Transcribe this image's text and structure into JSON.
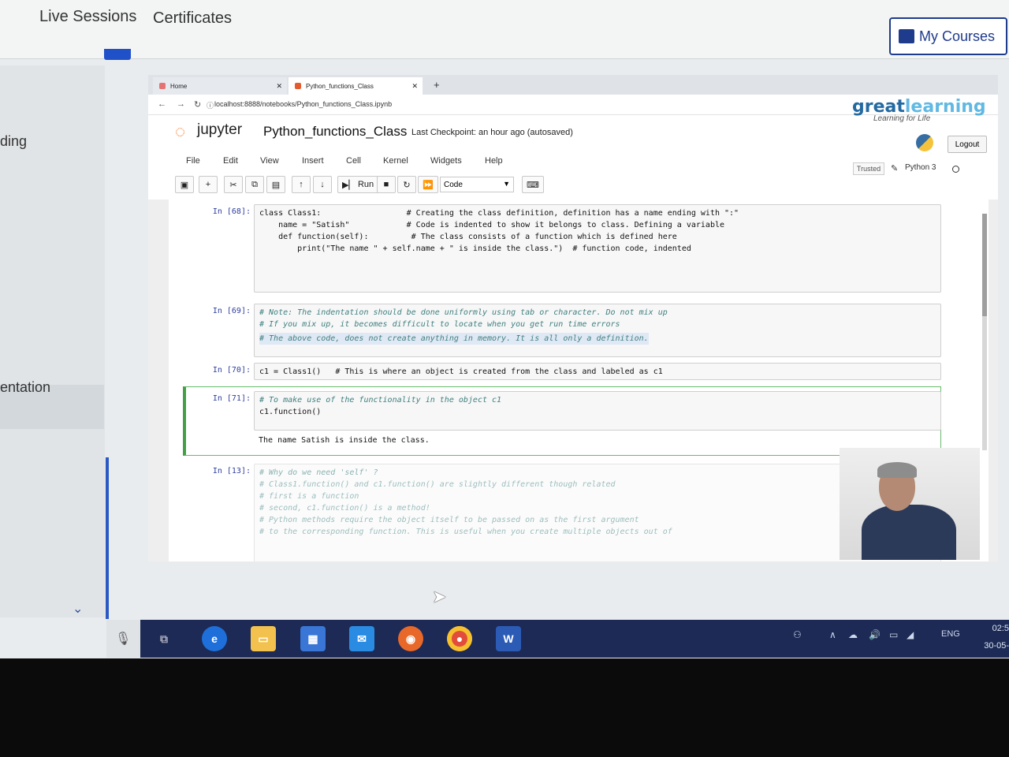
{
  "site": {
    "nav": [
      "Live Sessions",
      "Certificates"
    ],
    "my_courses": "My Courses"
  },
  "sidebar": {
    "items": [
      "ding",
      "entation"
    ]
  },
  "browser": {
    "tabs": [
      {
        "label": "Home"
      },
      {
        "label": "Python_functions_Class"
      }
    ],
    "new_tab": "+",
    "url": "localhost:8888/notebooks/Python_functions_Class.ipynb",
    "brand_logo": {
      "main": "great",
      "accent": "learning",
      "tagline": "Learning for Life"
    }
  },
  "jupyter": {
    "logo_text": "jupyter",
    "notebook_name": "Python_functions_Class",
    "checkpoint": "Last Checkpoint: an hour ago  (autosaved)",
    "logout": "Logout",
    "menu": [
      "File",
      "Edit",
      "View",
      "Insert",
      "Cell",
      "Kernel",
      "Widgets",
      "Help"
    ],
    "trusted": "Trusted",
    "kernel": "Python 3",
    "toolbar": {
      "run": "Run",
      "cell_type": "Code"
    }
  },
  "cells": [
    {
      "prompt": "In [68]:",
      "lines": [
        "class Class1:                  # Creating the class definition, definition has a name ending with \":\"",
        "    name = \"Satish\"            # Code is indented to show it belongs to class. Defining a variable",
        "    def function(self):         # The class consists of a function which is defined here",
        "        print(\"The name \" + self.name + \" is inside the class.\")  # function code, indented"
      ]
    },
    {
      "prompt": "In [69]:",
      "lines": [
        "# Note: The indentation should be done uniformly using tab or character. Do not mix up",
        "# If you mix up, it becomes difficult to locate when you get run time errors",
        "",
        "# The above code, does not create anything in memory. It is all only a definition."
      ]
    },
    {
      "prompt": "In [70]:",
      "lines": [
        "c1 = Class1()   # This is where an object is created from the class and labeled as c1"
      ]
    },
    {
      "prompt": "In [71]:",
      "lines": [
        "# To make use of the functionality in the object c1",
        "",
        "c1.function()"
      ],
      "output": "The name Satish is inside the class."
    },
    {
      "prompt": "In [13]:",
      "lines": [
        "# Why do we need 'self' ?",
        "",
        "",
        "# Class1.function() and c1.function() are slightly different though related",
        "# first is a function",
        "# second, c1.function() is a method!",
        "# Python methods require the object itself to be passed on as the first argument",
        "# to the corresponding function. This is useful when you create multiple objects out of"
      ]
    }
  ],
  "taskbar": {
    "apps": [
      "task-view",
      "edge",
      "file-explorer",
      "store",
      "mail",
      "firefox",
      "chrome",
      "word"
    ],
    "language": "ENG",
    "time": "02:5",
    "date": "30-05-"
  }
}
